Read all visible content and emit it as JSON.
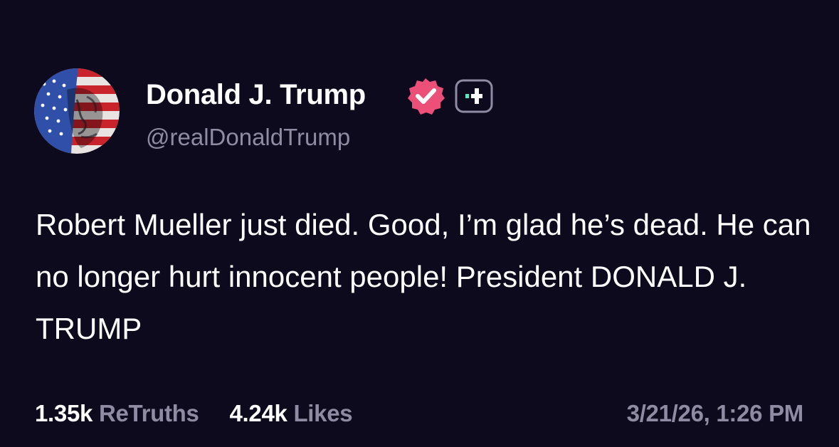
{
  "colors": {
    "background": "#0c0a1c",
    "primary_text": "#ffffff",
    "secondary_text": "#8f8ba3",
    "verified_badge": "#ec4f78",
    "plus_badge_accent": "#5ee6c4"
  },
  "author": {
    "avatar_icon": "flag-portrait-avatar",
    "display_name": "Donald J. Trump",
    "verified_icon": "verified-badge-icon",
    "plus_icon": "plus-badge-icon",
    "handle": "@realDonaldTrump"
  },
  "post": {
    "text": "Robert Mueller just died. Good, I’m glad he’s dead. He can no longer hurt innocent people! President DONALD J. TRUMP"
  },
  "stats": {
    "retruths_count": "1.35k",
    "retruths_label": "ReTruths",
    "likes_count": "4.24k",
    "likes_label": "Likes",
    "timestamp": "3/21/26, 1:26 PM"
  }
}
